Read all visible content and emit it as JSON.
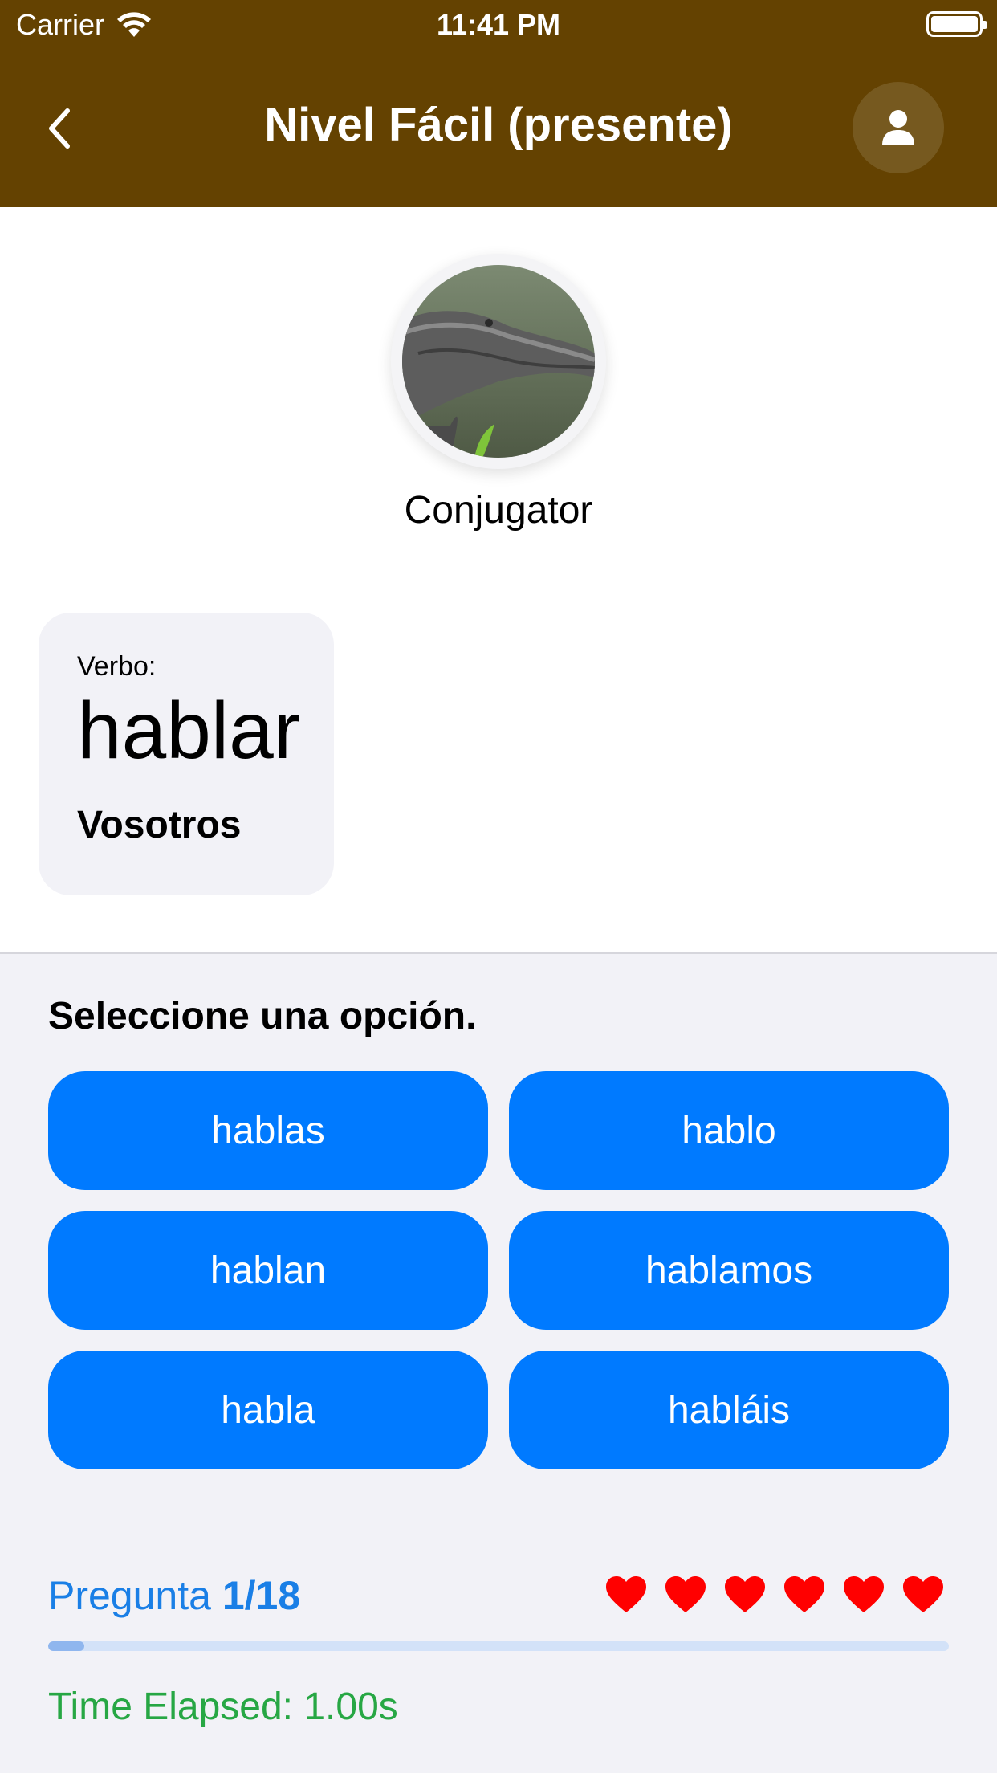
{
  "status_bar": {
    "carrier": "Carrier",
    "time": "11:41 PM"
  },
  "nav": {
    "title": "Nivel Fácil (presente)",
    "back_icon": "chevron-left-icon",
    "profile_icon": "person-icon"
  },
  "app": {
    "name": "Conjugator"
  },
  "verb_card": {
    "label": "Verbo:",
    "verb": "hablar",
    "person": "Vosotros"
  },
  "quiz": {
    "prompt": "Seleccione una opción.",
    "options": [
      "hablas",
      "hablo",
      "hablan",
      "hablamos",
      "habla",
      "habláis"
    ],
    "question_label": "Pregunta",
    "question_number": "1/18",
    "progress_fraction": 0.04,
    "lives": 6,
    "time_elapsed": "Time Elapsed: 1.00s"
  },
  "colors": {
    "nav_bg": "#644201",
    "button": "#007aff",
    "heart": "#ff0000",
    "counter": "#1a7fe6",
    "time": "#27a744"
  }
}
